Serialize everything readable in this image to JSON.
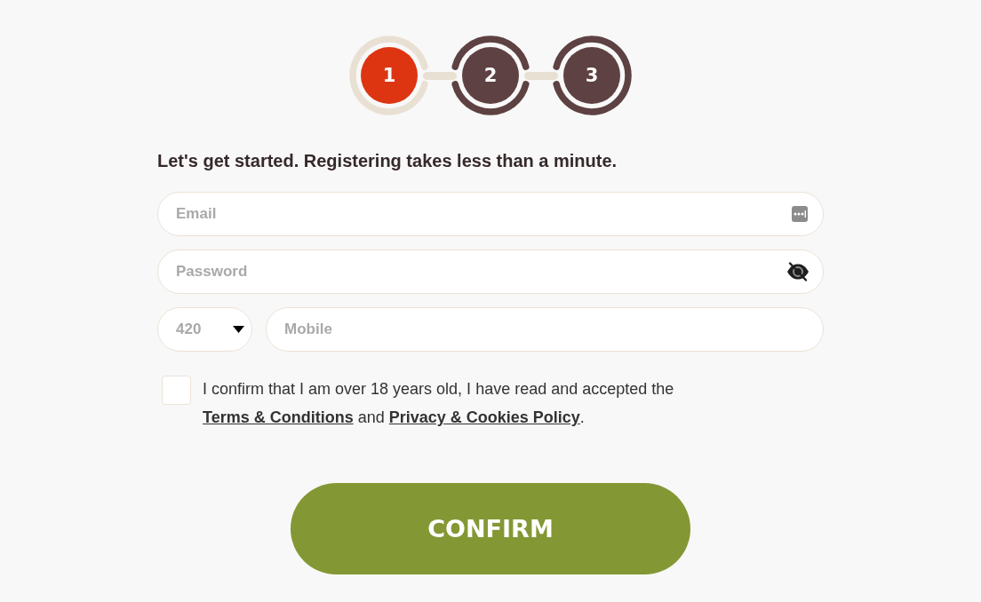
{
  "steps": [
    {
      "label": "1",
      "selected": true
    },
    {
      "label": "2",
      "selected": false
    },
    {
      "label": "3",
      "selected": false
    }
  ],
  "heading": "Let's get started. Registering takes less than a minute.",
  "fields": [
    {
      "kind": "email",
      "placeholder": "Email"
    },
    {
      "kind": "password",
      "placeholder": "Password"
    }
  ],
  "phone": {
    "country_code": "420",
    "placeholder": "Mobile"
  },
  "consent": {
    "checked": false,
    "parts": [
      {
        "kind": "text",
        "text": "I confirm that I am over 18 years old, I have read and accepted the "
      },
      {
        "kind": "link",
        "text": "Terms & Conditions"
      },
      {
        "kind": "text",
        "text": " and "
      },
      {
        "kind": "link",
        "text": "Privacy & Cookies Policy"
      },
      {
        "kind": "text",
        "text": "."
      }
    ]
  },
  "confirm_button": "CONFIRM"
}
